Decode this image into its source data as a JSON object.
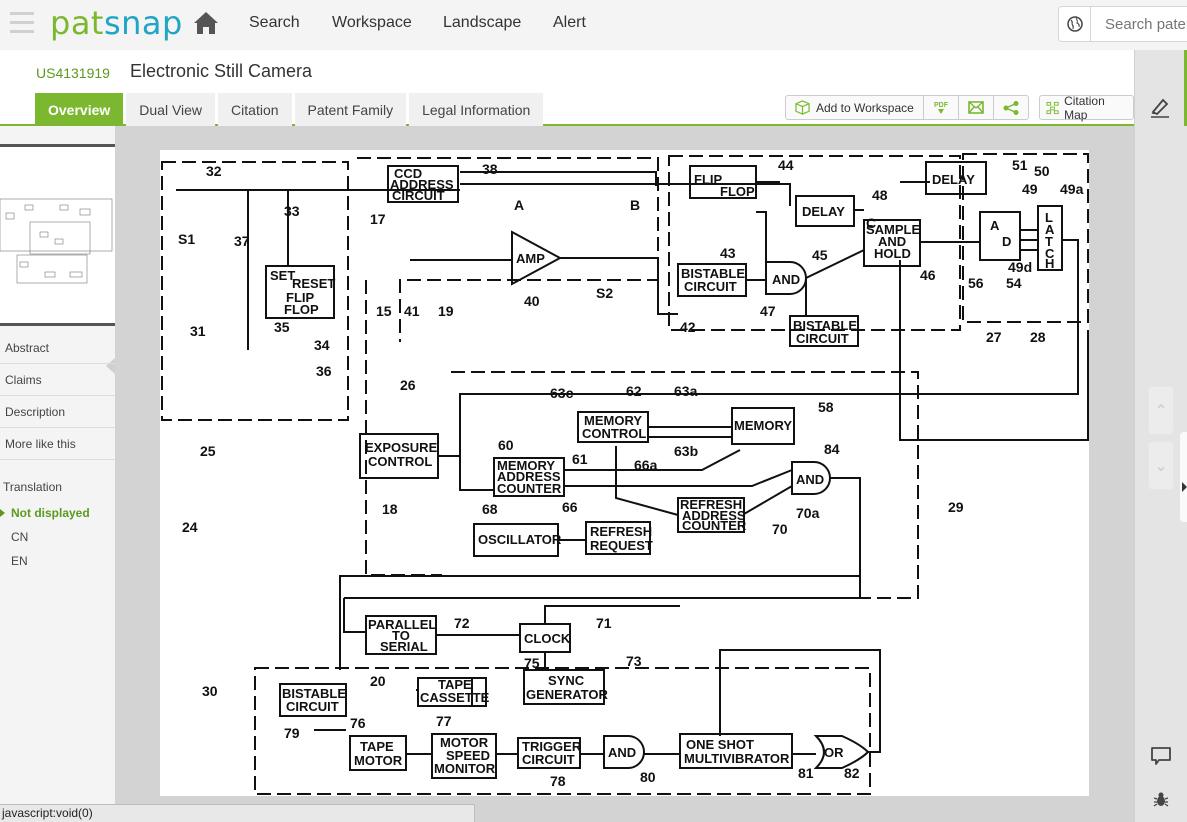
{
  "topbar": {
    "logo_part1": "pat",
    "logo_part2": "snap",
    "nav": [
      "Search",
      "Workspace",
      "Landscape",
      "Alert"
    ],
    "search_placeholder": "Search patents"
  },
  "patent": {
    "number": "US4131919",
    "title": "Electronic Still Camera"
  },
  "tabs": [
    "Overview",
    "Dual View",
    "Citation",
    "Patent Family",
    "Legal Information"
  ],
  "active_tab": "Overview",
  "actions": {
    "add_to_workspace": "Add to Workspace",
    "pdf": "PDF",
    "citation_map": "Citation Map"
  },
  "sidebar": {
    "items": [
      "Abstract",
      "Claims",
      "Description",
      "More like this"
    ],
    "translation_label": "Translation",
    "translation_options": [
      "Not displayed",
      "CN",
      "EN"
    ],
    "translation_selected": "Not displayed"
  },
  "statusbar": "javascript:void(0)",
  "colors": {
    "brand_green": "#7cb82f",
    "brand_blue": "#1fa5c6"
  },
  "drawing": {
    "blocks": {
      "ccd": [
        "CCD",
        "ADDRESS",
        "CIRCUIT"
      ],
      "setreset": [
        "SET",
        "RESET",
        "FLIP",
        "FLOP"
      ],
      "amp": "AMP",
      "flipflop": [
        "FLIP",
        "FLOP"
      ],
      "delay1": "DELAY",
      "delay2": "DELAY",
      "samplehold": [
        "SAMPLE",
        "AND",
        "HOLD"
      ],
      "ad": [
        "A",
        "D"
      ],
      "latch": [
        "L",
        "A",
        "T",
        "C",
        "H"
      ],
      "bistable1": [
        "BISTABLE",
        "CIRCUIT"
      ],
      "and1": "AND",
      "bistable2": [
        "BISTABLE",
        "CIRCUIT"
      ],
      "exposure": [
        "EXPOSURE",
        "CONTROL"
      ],
      "memctl": [
        "MEMORY",
        "CONTROL"
      ],
      "memory": "MEMORY",
      "memaddr": [
        "MEMORY",
        "ADDRESS",
        "COUNTER"
      ],
      "and2": "AND",
      "refaddr": [
        "REFRESH",
        "ADDRESS",
        "COUNTER"
      ],
      "oscillator": "OSCILLATOR",
      "refreq": [
        "REFRESH",
        "REQUEST"
      ],
      "p2s": [
        "PARALLEL",
        "TO",
        "SERIAL"
      ],
      "clock": "CLOCK",
      "sync": [
        "SYNC",
        "GENERATOR"
      ],
      "tapecass": [
        "TAPE",
        "CASSETTE"
      ],
      "bistable3": [
        "BISTABLE",
        "CIRCUIT"
      ],
      "tapemotor": [
        "TAPE",
        "MOTOR"
      ],
      "motorspeed": [
        "MOTOR",
        "SPEED",
        "MONITOR"
      ],
      "trigger": [
        "TRIGGER",
        "CIRCUIT"
      ],
      "and3": "AND",
      "oneshot": [
        "ONE SHOT",
        "MULTIVIBRATOR"
      ],
      "or": "OR"
    },
    "refs": [
      "32",
      "38",
      "A",
      "B",
      "33",
      "37",
      "S1",
      "17",
      "15",
      "41",
      "19",
      "40",
      "S2",
      "31",
      "35",
      "34",
      "36",
      "26",
      "25",
      "24",
      "44",
      "48",
      "C",
      "51",
      "50",
      "49",
      "49a",
      "43",
      "45",
      "46",
      "42",
      "47",
      "49d",
      "56",
      "54",
      "27",
      "28",
      "63c",
      "62",
      "63a",
      "58",
      "60",
      "61",
      "66a",
      "63b",
      "84",
      "68",
      "66",
      "70a",
      "70",
      "18",
      "29",
      "72",
      "71",
      "75",
      "73",
      "20",
      "30",
      "79",
      "76",
      "77",
      "78",
      "80",
      "81",
      "82"
    ]
  }
}
